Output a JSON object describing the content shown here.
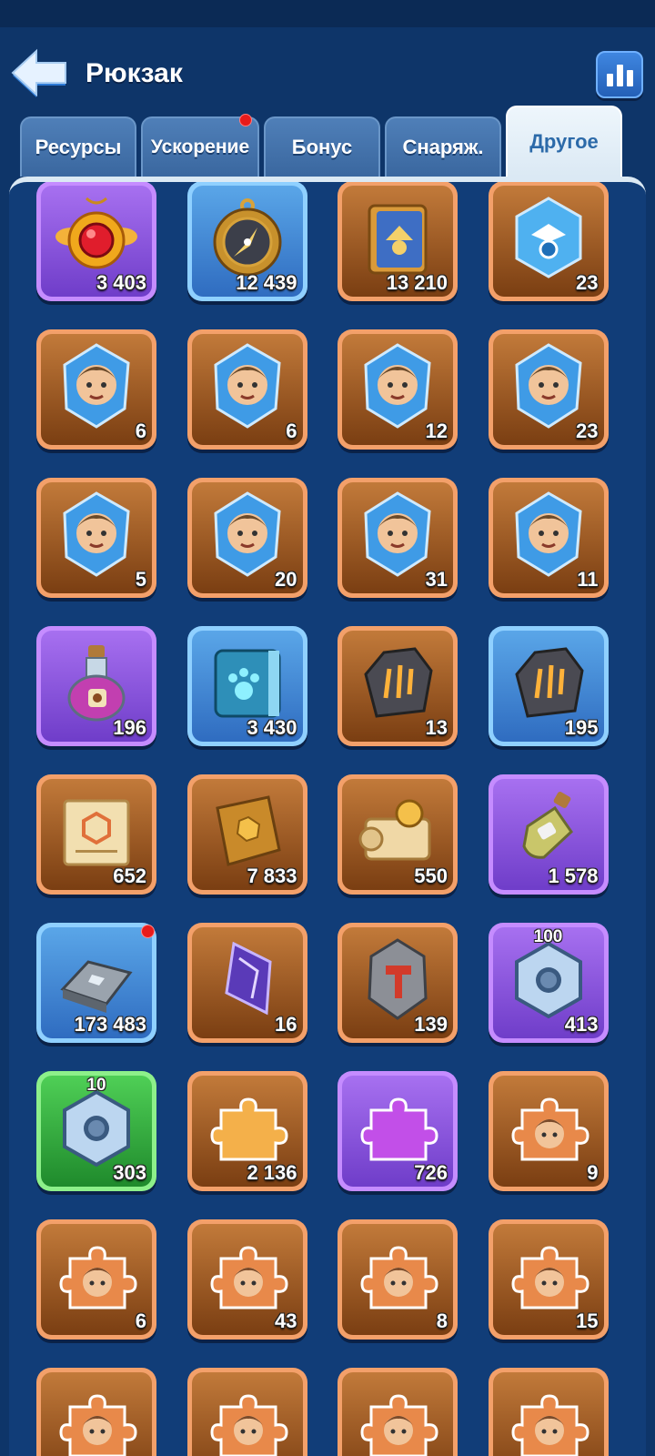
{
  "header": {
    "title": "Рюкзак",
    "back_icon": "back-arrow-icon",
    "stats_icon": "bar-chart-icon"
  },
  "tabs": [
    {
      "label": "Ресурсы",
      "active": false,
      "dot": false
    },
    {
      "label": "Ускорение",
      "active": false,
      "dot": true
    },
    {
      "label": "Бонус",
      "active": false,
      "dot": false
    },
    {
      "label": "Снаряж.",
      "active": false,
      "dot": false
    },
    {
      "label": "Другое",
      "active": true,
      "dot": false
    }
  ],
  "colors": {
    "background": "#0e3569",
    "panel": "#113d78",
    "notification": "#e81b1b",
    "active_tab_text": "#2c6aa9"
  },
  "items": [
    {
      "name": "ruby-medallion",
      "icon": "ruby-medallion-icon",
      "rarity": "purple",
      "count": "3 403"
    },
    {
      "name": "golden-compass",
      "icon": "compass-icon",
      "rarity": "blue",
      "count": "12 439"
    },
    {
      "name": "skill-tome",
      "icon": "skill-book-icon",
      "rarity": "orange",
      "count": "13 210"
    },
    {
      "name": "hero-crystal-generic",
      "icon": "hero-crystal-icon",
      "rarity": "orange",
      "count": "23"
    },
    {
      "name": "hero-shard-blonde",
      "icon": "hero-shard-icon",
      "rarity": "orange",
      "count": "6"
    },
    {
      "name": "hero-shard-grandma",
      "icon": "hero-shard-icon",
      "rarity": "orange",
      "count": "6"
    },
    {
      "name": "hero-shard-bearded",
      "icon": "hero-shard-icon",
      "rarity": "orange",
      "count": "12"
    },
    {
      "name": "hero-shard-elder",
      "icon": "hero-shard-icon",
      "rarity": "orange",
      "count": "23"
    },
    {
      "name": "hero-shard-redbeard",
      "icon": "hero-shard-icon",
      "rarity": "orange",
      "count": "5"
    },
    {
      "name": "hero-shard-grayhair",
      "icon": "hero-shard-icon",
      "rarity": "orange",
      "count": "20"
    },
    {
      "name": "hero-shard-bluehair",
      "icon": "hero-shard-icon",
      "rarity": "orange",
      "count": "31"
    },
    {
      "name": "hero-shard-witch",
      "icon": "hero-shard-icon",
      "rarity": "orange",
      "count": "11"
    },
    {
      "name": "pet-potion",
      "icon": "potion-bottle-icon",
      "rarity": "purple",
      "count": "196"
    },
    {
      "name": "pet-book",
      "icon": "paw-book-icon",
      "rarity": "blue",
      "count": "3 430"
    },
    {
      "name": "claw-stone-dark",
      "icon": "claw-stone-icon",
      "rarity": "orange",
      "count": "13"
    },
    {
      "name": "claw-stone-gray",
      "icon": "claw-stone-icon",
      "rarity": "blue",
      "count": "195"
    },
    {
      "name": "blueprint-scroll",
      "icon": "blueprint-icon",
      "rarity": "orange",
      "count": "652"
    },
    {
      "name": "gold-book",
      "icon": "gold-book-icon",
      "rarity": "orange",
      "count": "7 833"
    },
    {
      "name": "sealed-scroll",
      "icon": "scroll-icon",
      "rarity": "orange",
      "count": "550"
    },
    {
      "name": "oil-bottle",
      "icon": "oil-bottle-icon",
      "rarity": "purple",
      "count": "1 578"
    },
    {
      "name": "iron-ingot",
      "icon": "iron-ingot-icon",
      "rarity": "blue",
      "count": "173 483",
      "dot": true
    },
    {
      "name": "purple-crystal",
      "icon": "purple-crystal-icon",
      "rarity": "orange",
      "count": "16"
    },
    {
      "name": "forge-stone",
      "icon": "hammer-stone-icon",
      "rarity": "orange",
      "count": "139"
    },
    {
      "name": "hex-nut-100",
      "icon": "hex-nut-icon",
      "rarity": "purple",
      "count": "413",
      "top": "100"
    },
    {
      "name": "hex-nut-10",
      "icon": "hex-nut-icon",
      "rarity": "green",
      "count": "303",
      "top": "10"
    },
    {
      "name": "puzzle-gold",
      "icon": "puzzle-piece-icon",
      "rarity": "orange",
      "count": "2 136"
    },
    {
      "name": "puzzle-purple",
      "icon": "puzzle-piece-icon",
      "rarity": "purple",
      "count": "726"
    },
    {
      "name": "puzzle-hero-1",
      "icon": "hero-puzzle-icon",
      "rarity": "orange",
      "count": "9"
    },
    {
      "name": "puzzle-hero-2",
      "icon": "hero-puzzle-icon",
      "rarity": "orange",
      "count": "6"
    },
    {
      "name": "puzzle-hero-3",
      "icon": "hero-puzzle-icon",
      "rarity": "orange",
      "count": "43"
    },
    {
      "name": "puzzle-hero-4",
      "icon": "hero-puzzle-icon",
      "rarity": "orange",
      "count": "8"
    },
    {
      "name": "puzzle-hero-5",
      "icon": "hero-puzzle-icon",
      "rarity": "orange",
      "count": "15"
    },
    {
      "name": "puzzle-hero-6",
      "icon": "hero-puzzle-icon",
      "rarity": "orange",
      "count": ""
    },
    {
      "name": "puzzle-hero-7",
      "icon": "hero-puzzle-icon",
      "rarity": "orange",
      "count": ""
    },
    {
      "name": "puzzle-hero-8",
      "icon": "hero-puzzle-icon",
      "rarity": "orange",
      "count": ""
    },
    {
      "name": "puzzle-hero-9",
      "icon": "hero-puzzle-icon",
      "rarity": "orange",
      "count": ""
    }
  ]
}
